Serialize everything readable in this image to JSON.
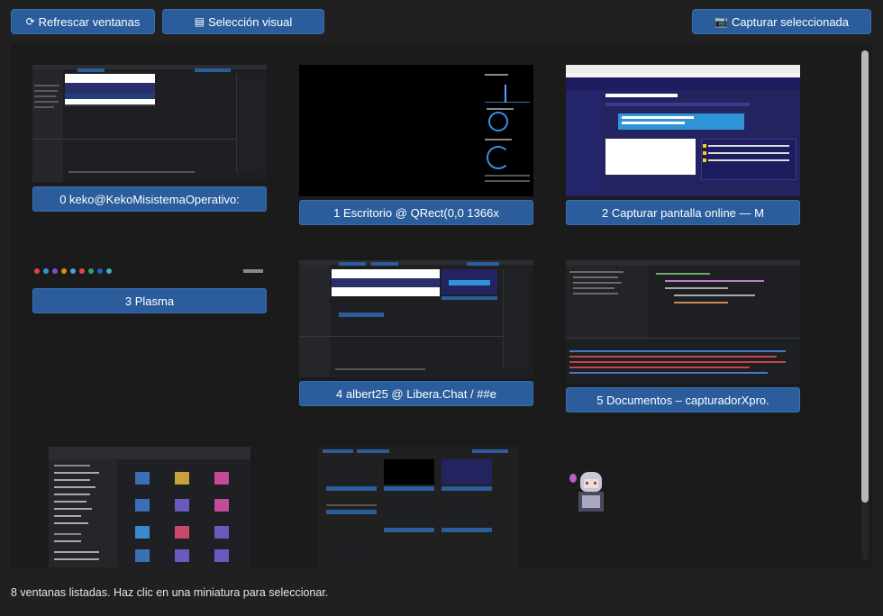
{
  "toolbar": {
    "refresh_icon": "⟳",
    "refresh_label": "Refrescar ventanas",
    "visual_icon": "▤",
    "visual_label": "Selección visual",
    "capture_icon": "📷",
    "capture_label": "Capturar seleccionada"
  },
  "windows": [
    {
      "label": "0 keko@KekoMisistemaOperativo:"
    },
    {
      "label": "1 Escritorio @ QRect(0,0 1366x"
    },
    {
      "label": "2 Capturar pantalla online — M"
    },
    {
      "label": "3 Plasma"
    },
    {
      "label": "4 albert25 @ Libera.Chat / ##e"
    },
    {
      "label": "5 Documentos – capturadorXpro."
    }
  ],
  "status": "8 ventanas listadas. Haz clic en una miniatura para seleccionar.",
  "colors": {
    "accent": "#2b5d9c",
    "background": "#202020",
    "panel": "#1b1b1b"
  }
}
